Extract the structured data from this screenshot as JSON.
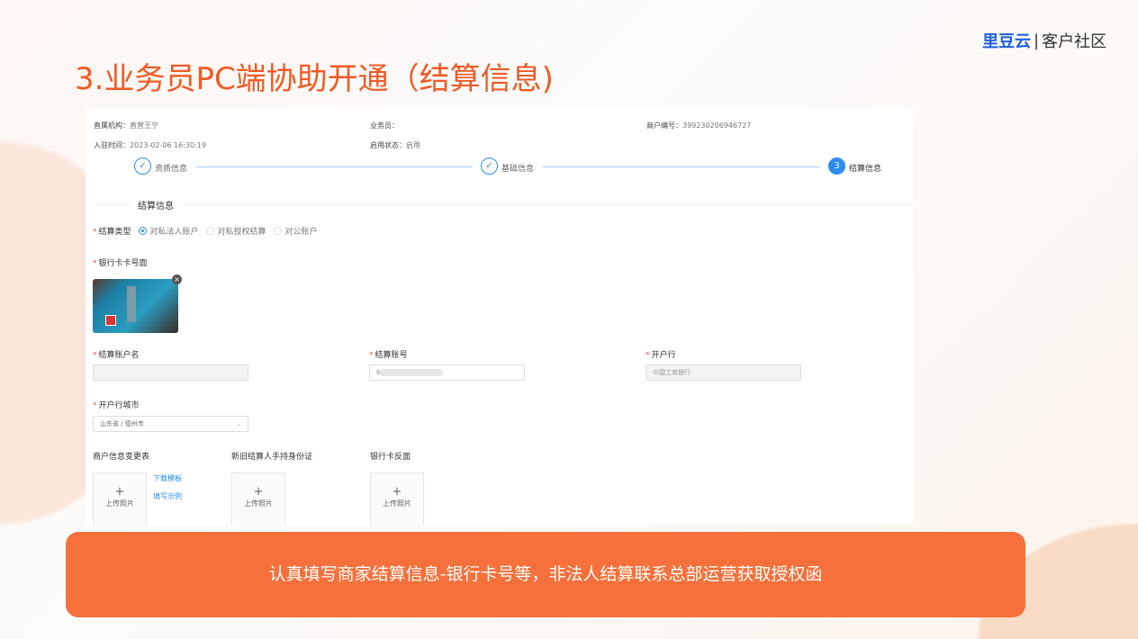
{
  "logo": {
    "brand": "里豆云",
    "separator": "|",
    "community": "客户社区"
  },
  "title": "3.业务员PC端协助开通（结算信息)",
  "info": {
    "org_label": "直属机构：",
    "org_value": "直营王宁",
    "sales_label": "业务员：",
    "sales_value": "",
    "merchant_no_label": "商户编号：",
    "merchant_no_value": "399230206946727",
    "join_time_label": "入驻时间：",
    "join_time_value": "2023-02-06 16:30:19",
    "status_label": "启用状态：",
    "status_value": "启用"
  },
  "steps": [
    {
      "label": "资质信息",
      "state": "done",
      "icon": "check-icon"
    },
    {
      "label": "基础信息",
      "state": "done",
      "icon": "check-icon"
    },
    {
      "label": "结算信息",
      "state": "active",
      "number": "3"
    }
  ],
  "section_title": "结算信息",
  "settlement_type": {
    "label": "结算类型",
    "options": [
      "对私法人账户",
      "对私授权结算",
      "对公账户"
    ],
    "selected": 0
  },
  "bank_card_front": {
    "label": "银行卡卡号面",
    "remove_icon": "close-icon"
  },
  "fields": {
    "account_name": {
      "label": "结算账户名",
      "value": ""
    },
    "account_no": {
      "label": "结算账号",
      "value": "6"
    },
    "bank": {
      "label": "开户行",
      "placeholder": "中国工商银行"
    },
    "bank_city": {
      "label": "开户行城市",
      "value": "山东省 / 德州市"
    }
  },
  "uploads": [
    {
      "label": "商户信息变更表",
      "button": "上传照片",
      "links": [
        "下载模板",
        "填写示例"
      ]
    },
    {
      "label": "新旧结算人手持身份证",
      "button": "上传照片"
    },
    {
      "label": "银行卡反面",
      "button": "上传照片"
    }
  ],
  "upload_plus": "+",
  "banner": "认真填写商家结算信息-银行卡号等，非法人结算联系总部运营获取授权函",
  "colors": {
    "accent": "#f05a24",
    "banner": "#f5703b",
    "primary": "#2d8cf0"
  }
}
